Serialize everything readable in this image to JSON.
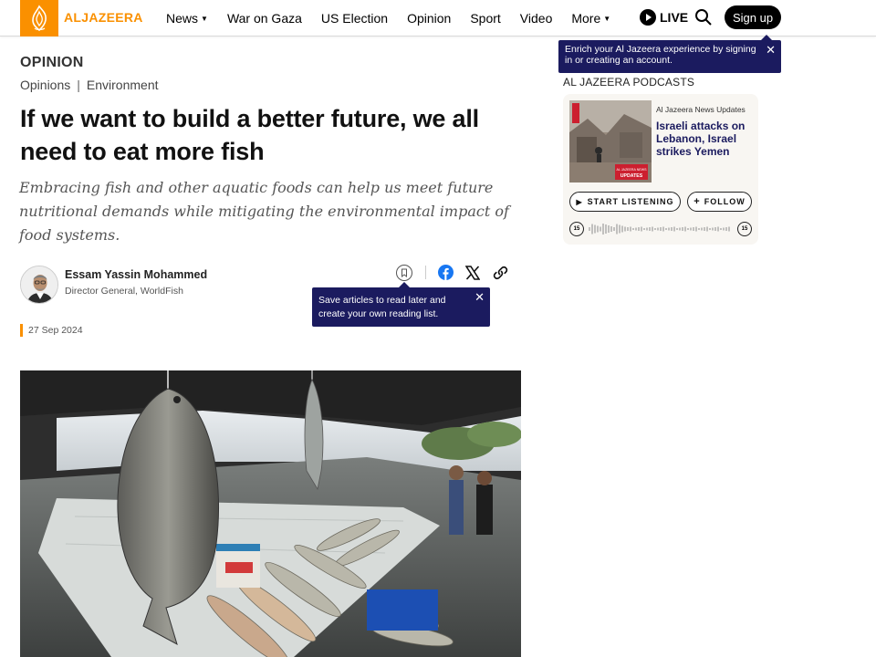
{
  "header": {
    "logo_text": "ALJAZEERA",
    "nav": [
      "News",
      "War on Gaza",
      "US Election",
      "Opinion",
      "Sport",
      "Video",
      "More"
    ],
    "live_label": "LIVE",
    "signup_label": "Sign up",
    "brand_color": "#fa9000"
  },
  "enrich_tooltip": {
    "text": "Enrich your Al Jazeera experience by signing in or creating an account.",
    "close": "✕"
  },
  "article": {
    "section": "OPINION",
    "breadcrumbs": [
      "Opinions",
      "Environment"
    ],
    "breadcrumb_sep": "|",
    "headline": "If we want to build a better future, we all need to eat more fish",
    "subheadline": "Embracing fish and other aquatic foods can help us meet future nutritional demands while mitigating the environmental impact of food systems.",
    "author": {
      "name": "Essam Yassin Mohammed",
      "title": "Director General, WorldFish"
    },
    "date": "27 Sep 2024"
  },
  "save_tooltip": {
    "text": "Save articles to read later and create your own reading list.",
    "close": "✕"
  },
  "podcasts": {
    "title": "AL JAZEERA PODCASTS",
    "show": "Al Jazeera News Updates",
    "episode": "Israeli attacks on Lebanon, Israel strikes Yemen",
    "thumb_badge_top": "AL JAZEERA NEWS",
    "thumb_badge_bottom": "UPDATES",
    "listen_label": "START LISTENING",
    "follow_label": "FOLLOW",
    "rewind_label": "15",
    "forward_label": "15"
  }
}
